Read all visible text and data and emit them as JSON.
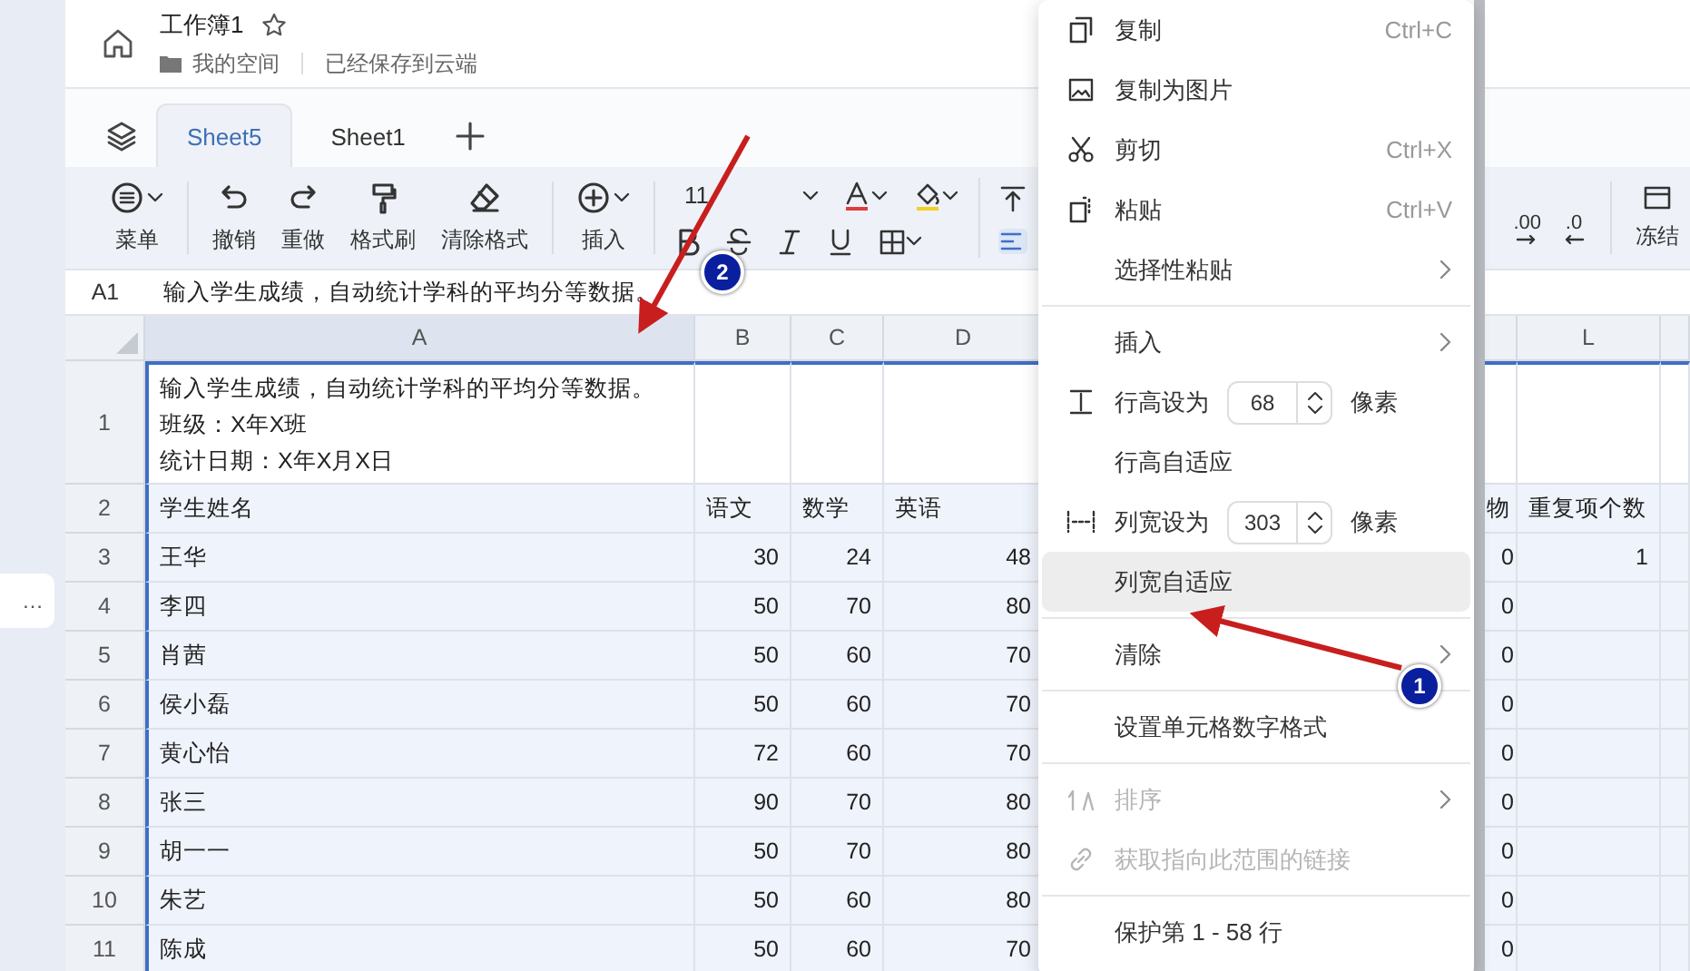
{
  "sidebar": {
    "item": "…"
  },
  "header": {
    "title": "工作簿1",
    "starred": false,
    "location": "我的空间",
    "save_status": "已经保存到云端"
  },
  "sheet_tabs": [
    {
      "label": "Sheet5",
      "selected": true
    },
    {
      "label": "Sheet1",
      "selected": false
    }
  ],
  "toolbar": {
    "groups": [
      [
        {
          "kind": "menu",
          "label": "菜单"
        }
      ],
      [
        {
          "kind": "undo",
          "label": "撤销"
        },
        {
          "kind": "redo",
          "label": "重做"
        },
        {
          "kind": "painter",
          "label": "格式刷"
        },
        {
          "kind": "eraser",
          "label": "清除格式"
        }
      ],
      [
        {
          "kind": "insert",
          "label": "插入"
        }
      ]
    ],
    "font_size": "11",
    "decimal_buttons": [
      ".00",
      ".0"
    ],
    "freeze": "冻结"
  },
  "formula_bar": {
    "cell": "A1",
    "content": "输入学生成绩，自动统计学科的平均分等数据。"
  },
  "grid": {
    "columns": [
      {
        "label": "A",
        "selected": true
      },
      {
        "label": "B",
        "selected": false
      },
      {
        "label": "C",
        "selected": false
      },
      {
        "label": "D",
        "selected": false
      },
      {
        "selected": false
      },
      {
        "label": "L",
        "selected": false
      },
      {
        "selected": false
      }
    ],
    "rows": [
      {
        "number": "1",
        "kind": "title",
        "selected": false,
        "a": [
          "输入学生成绩，自动统计学科的平均分等数据。",
          "班级：X年X班",
          "统计日期：X年X月X日"
        ]
      },
      {
        "number": "2",
        "kind": "header",
        "selected": true,
        "a": "学生姓名",
        "b": "语文",
        "c": "数学",
        "d": "英语",
        "k": "物",
        "l": "重复项个数"
      },
      {
        "number": "3",
        "kind": "data",
        "selected": true,
        "a": "王华",
        "b": "30",
        "c": "24",
        "d": "48",
        "k": "0",
        "l": "1"
      },
      {
        "number": "4",
        "kind": "data",
        "selected": true,
        "a": "李四",
        "b": "50",
        "c": "70",
        "d": "80",
        "k": "0"
      },
      {
        "number": "5",
        "kind": "data",
        "selected": true,
        "a": "肖茜",
        "b": "50",
        "c": "60",
        "d": "70",
        "k": "0"
      },
      {
        "number": "6",
        "kind": "data",
        "selected": true,
        "a": "侯小磊",
        "b": "50",
        "c": "60",
        "d": "70",
        "k": "0"
      },
      {
        "number": "7",
        "kind": "data",
        "selected": true,
        "a": "黄心怡",
        "b": "72",
        "c": "60",
        "d": "70",
        "k": "0"
      },
      {
        "number": "8",
        "kind": "data",
        "selected": true,
        "a": "张三",
        "b": "90",
        "c": "70",
        "d": "80",
        "k": "0"
      },
      {
        "number": "9",
        "kind": "data",
        "selected": true,
        "a": "胡一一",
        "b": "50",
        "c": "70",
        "d": "80",
        "k": "0"
      },
      {
        "number": "10",
        "kind": "data",
        "selected": true,
        "a": "朱艺",
        "b": "50",
        "c": "60",
        "d": "80",
        "k": "0"
      },
      {
        "number": "11",
        "kind": "data",
        "selected": true,
        "a": "陈成",
        "b": "50",
        "c": "60",
        "d": "70",
        "k": "0"
      }
    ]
  },
  "context_menu": {
    "items": [
      {
        "kind": "item",
        "label": "复制",
        "shortcut": "Ctrl+C",
        "disabled": false,
        "selected": false
      },
      {
        "kind": "item",
        "label": "复制为图片",
        "disabled": false,
        "selected": false
      },
      {
        "kind": "item",
        "label": "剪切",
        "shortcut": "Ctrl+X",
        "disabled": false,
        "selected": false
      },
      {
        "kind": "item",
        "label": "粘贴",
        "shortcut": "Ctrl+V",
        "disabled": false,
        "selected": false
      },
      {
        "kind": "submenu",
        "label": "选择性粘贴",
        "disabled": false,
        "selected": false
      },
      {
        "kind": "divider"
      },
      {
        "kind": "submenu",
        "label": "插入",
        "disabled": false,
        "selected": false
      },
      {
        "kind": "size",
        "label": "行高设为",
        "value": "68",
        "unit": "像素",
        "disabled": false,
        "selected": false
      },
      {
        "kind": "item",
        "label": "行高自适应",
        "disabled": false,
        "selected": false
      },
      {
        "kind": "size",
        "label": "列宽设为",
        "value": "303",
        "unit": "像素",
        "disabled": false,
        "selected": false
      },
      {
        "kind": "item",
        "label": "列宽自适应",
        "disabled": false,
        "selected": true
      },
      {
        "kind": "divider"
      },
      {
        "kind": "submenu",
        "label": "清除",
        "disabled": false,
        "selected": false
      },
      {
        "kind": "divider"
      },
      {
        "kind": "item",
        "label": "设置单元格数字格式",
        "disabled": false,
        "selected": false
      },
      {
        "kind": "divider"
      },
      {
        "kind": "submenu",
        "label": "排序",
        "disabled": true,
        "selected": false
      },
      {
        "kind": "item",
        "label": "获取指向此范围的链接",
        "disabled": true,
        "selected": false
      },
      {
        "kind": "divider"
      },
      {
        "kind": "item",
        "label": "保护第 1 - 58 行",
        "disabled": false,
        "selected": false
      }
    ]
  },
  "annotations": [
    {
      "number": "1"
    },
    {
      "number": "2"
    }
  ]
}
